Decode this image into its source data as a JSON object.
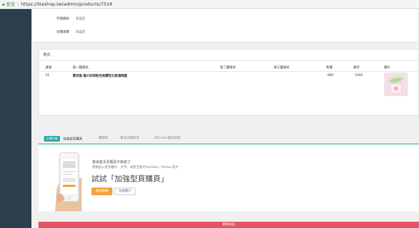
{
  "browser": {
    "secure_label": "安全",
    "url": "https://liteshop.tw/admin/products/7518"
  },
  "fields": [
    {
      "label": "存檔價格",
      "value": "未設定"
    },
    {
      "label": "加價運費",
      "value": "未設定"
    }
  ],
  "spec": {
    "title": "款式",
    "headers": [
      "貨號",
      "第一層樣式",
      "第二層樣式",
      "第三層樣式",
      "售價",
      "庫存",
      "圖片"
    ],
    "row": {
      "sku": "01",
      "variant1": "寶貝猫 貓爪肉球粉色桃樱型白瓷湯碗盤",
      "variant2": "",
      "variant3": "",
      "price": "880",
      "stock": "1000"
    }
  },
  "tabs": {
    "badge": "計費功能",
    "items": [
      "加強型頁購頁",
      "購物車",
      "單頁式購買頁",
      "QRCode 驗證頁碼"
    ]
  },
  "promo": {
    "line1": "覺得基本頁購頁不夠用了",
    "line2": "想要加入更多圖片、文字，再甚至影片YouTube / Vimeo 影片",
    "headline": "試試「加強型頁購頁」",
    "primary_button": "開始編輯",
    "secondary_button": "功能簡介"
  },
  "danger_button": "刪除商品"
}
